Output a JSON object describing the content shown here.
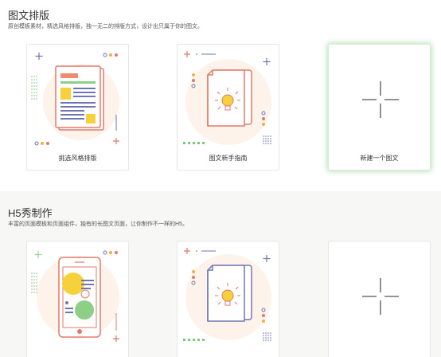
{
  "sections": [
    {
      "title": "图文排版",
      "subtitle": "原创模板素材，精选风格排版，独一无二的排版方式，设计出只属于你的图文。",
      "cards": [
        {
          "label": "挑选风格排版",
          "icon": "article-layout-icon"
        },
        {
          "label": "图文新手指南",
          "icon": "guide-book-icon"
        },
        {
          "label": "新建一个图文",
          "icon": "plus-icon"
        }
      ]
    },
    {
      "title": "H5秀制作",
      "subtitle": "丰富的页面模板和页面组件，独有的长图文页面，让你制作不一样的H5。",
      "cards": [
        {
          "label": "",
          "icon": "phone-layout-icon"
        },
        {
          "label": "",
          "icon": "guide-book-icon"
        },
        {
          "label": "",
          "icon": "plus-icon"
        }
      ]
    }
  ],
  "colors": {
    "accent_green": "#7ec87a",
    "illustration_red": "#e07a6a",
    "illustration_blue": "#7076b3",
    "illustration_yellow": "#f7d13a"
  }
}
